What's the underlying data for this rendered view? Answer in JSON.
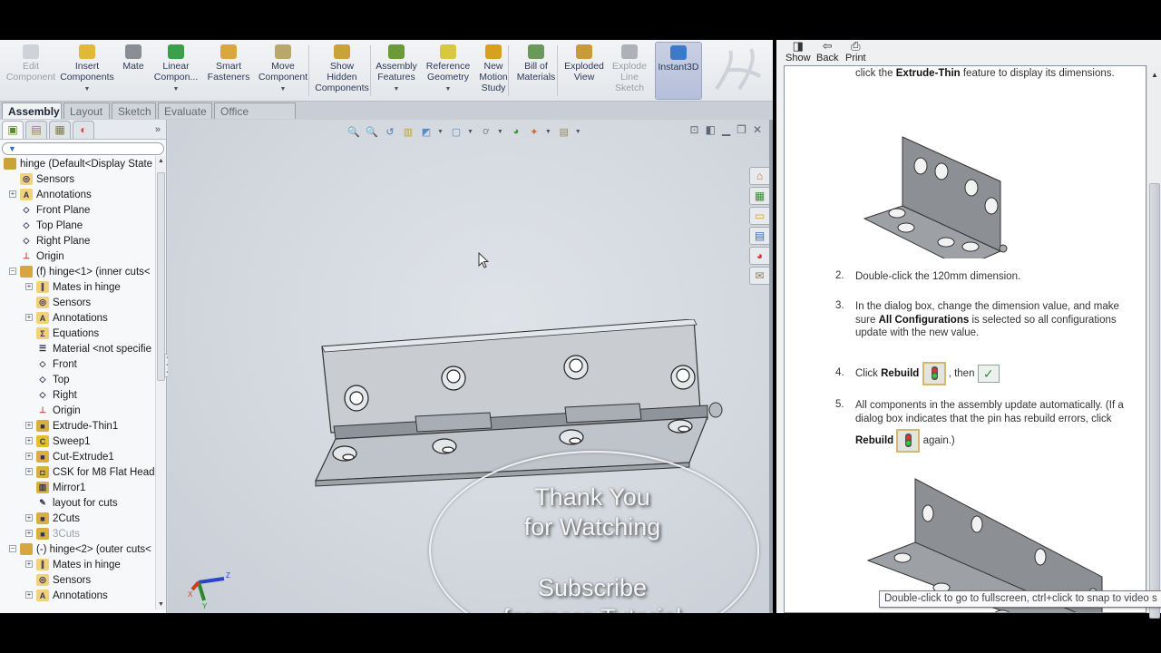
{
  "solidworks": {
    "command_manager": [
      {
        "label": "Edit\nComponent",
        "icon": "edit-component-icon",
        "state": "disabled"
      },
      {
        "label": "Insert\nComponents",
        "icon": "insert-components-icon",
        "dropdown": true
      },
      {
        "label": "Mate",
        "icon": "mate-icon"
      },
      {
        "label": "Linear\nCompon...",
        "icon": "linear-pattern-icon",
        "dropdown": true
      },
      {
        "label": "Smart\nFasteners",
        "icon": "smart-fasteners-icon"
      },
      {
        "label": "Move\nComponent",
        "icon": "move-component-icon",
        "dropdown": true
      },
      {
        "label": "Show\nHidden\nComponents",
        "icon": "show-hidden-icon"
      },
      {
        "label": "Assembly\nFeatures",
        "icon": "assembly-features-icon",
        "dropdown": true
      },
      {
        "label": "Reference\nGeometry",
        "icon": "reference-geometry-icon",
        "dropdown": true
      },
      {
        "label": "New\nMotion\nStudy",
        "icon": "motion-study-icon"
      },
      {
        "label": "Bill of\nMaterials",
        "icon": "bill-of-materials-icon"
      },
      {
        "label": "Exploded\nView",
        "icon": "exploded-view-icon"
      },
      {
        "label": "Explode\nLine\nSketch",
        "icon": "explode-line-sketch-icon",
        "state": "disabled"
      },
      {
        "label": "Instant3D",
        "icon": "instant3d-icon",
        "state": "active"
      }
    ],
    "tabs": [
      {
        "label": "Assembly",
        "active": true
      },
      {
        "label": "Layout"
      },
      {
        "label": "Sketch"
      },
      {
        "label": "Evaluate"
      },
      {
        "label": "Office Products"
      }
    ],
    "feature_manager": {
      "panel_tabs": [
        "featuremanager-tree-icon",
        "propertymanager-icon",
        "configurationmanager-icon",
        "display-manager-icon"
      ],
      "more_label": "»",
      "filter_placeholder": "",
      "tree": [
        {
          "label": "hinge  (Default<Display State",
          "level": 0,
          "icon": "assembly-icon"
        },
        {
          "label": "Sensors",
          "level": 1,
          "icon": "sensors-folder-icon"
        },
        {
          "label": "Annotations",
          "level": 1,
          "icon": "annotations-folder-icon",
          "expandable": true
        },
        {
          "label": "Front Plane",
          "level": 1,
          "icon": "plane-icon"
        },
        {
          "label": "Top Plane",
          "level": 1,
          "icon": "plane-icon"
        },
        {
          "label": "Right Plane",
          "level": 1,
          "icon": "plane-icon"
        },
        {
          "label": "Origin",
          "level": 1,
          "icon": "origin-icon"
        },
        {
          "label": "(f) hinge<1> (inner cuts<",
          "level": 1,
          "icon": "part-icon",
          "expandable": true,
          "expanded": true
        },
        {
          "label": "Mates in hinge",
          "level": 2,
          "icon": "mates-folder-icon",
          "expandable": true
        },
        {
          "label": "Sensors",
          "level": 2,
          "icon": "sensors-folder-icon"
        },
        {
          "label": "Annotations",
          "level": 2,
          "icon": "annotations-folder-icon",
          "expandable": true
        },
        {
          "label": "Equations",
          "level": 2,
          "icon": "equations-folder-icon"
        },
        {
          "label": "Material <not specifie",
          "level": 2,
          "icon": "material-icon"
        },
        {
          "label": "Front",
          "level": 2,
          "icon": "plane-icon"
        },
        {
          "label": "Top",
          "level": 2,
          "icon": "plane-icon"
        },
        {
          "label": "Right",
          "level": 2,
          "icon": "plane-icon"
        },
        {
          "label": "Origin",
          "level": 2,
          "icon": "origin-icon"
        },
        {
          "label": "Extrude-Thin1",
          "level": 2,
          "icon": "extrude-icon",
          "expandable": true
        },
        {
          "label": "Sweep1",
          "level": 2,
          "icon": "sweep-icon",
          "expandable": true
        },
        {
          "label": "Cut-Extrude1",
          "level": 2,
          "icon": "cut-extrude-icon",
          "expandable": true
        },
        {
          "label": "CSK for M8 Flat Head",
          "level": 2,
          "icon": "hole-wizard-icon",
          "expandable": true
        },
        {
          "label": "Mirror1",
          "level": 2,
          "icon": "mirror-icon"
        },
        {
          "label": "layout for cuts",
          "level": 2,
          "icon": "sketch-icon"
        },
        {
          "label": "2Cuts",
          "level": 2,
          "icon": "cut-extrude-icon",
          "expandable": true
        },
        {
          "label": "3Cuts",
          "level": 2,
          "icon": "cut-extrude-icon",
          "expandable": true,
          "suppressed": true
        },
        {
          "label": "(-) hinge<2> (outer cuts<",
          "level": 1,
          "icon": "part-icon",
          "expandable": true,
          "expanded": true
        },
        {
          "label": "Mates in hinge",
          "level": 2,
          "icon": "mates-folder-icon",
          "expandable": true
        },
        {
          "label": "Sensors",
          "level": 2,
          "icon": "sensors-folder-icon"
        },
        {
          "label": "Annotations",
          "level": 2,
          "icon": "annotations-folder-icon",
          "expandable": true
        }
      ]
    },
    "heads_up_toolbar": [
      "zoom-to-fit-icon",
      "zoom-to-area-icon",
      "previous-view-icon",
      "section-view-icon",
      "view-orientation-icon",
      "display-style-icon",
      "hide-show-items-icon",
      "edit-appearance-icon",
      "apply-scene-icon",
      "view-settings-icon"
    ],
    "window_controls": [
      "tile-horizontal-icon",
      "tile-vertical-icon",
      "minimize-icon",
      "restore-icon",
      "close-icon"
    ],
    "task_pane_tabs": [
      "solidworks-resources-icon",
      "design-library-icon",
      "file-explorer-icon",
      "view-palette-icon",
      "appearances-scenes-icon",
      "custom-properties-icon"
    ],
    "overlay": {
      "line1": "Thank You",
      "line2": "for Watching",
      "line3": "Subscribe",
      "line4": "for more Tutorial"
    },
    "triad_axes": [
      "X",
      "Y",
      "Z"
    ]
  },
  "help": {
    "toolbar": [
      {
        "label": "Show",
        "icon": "show-icon"
      },
      {
        "label": "Back",
        "icon": "back-arrow-icon"
      },
      {
        "label": "Print",
        "icon": "printer-icon"
      }
    ],
    "intro": {
      "pre": "click the ",
      "bold": "Extrude-Thin",
      "post": " feature to display its dimensions."
    },
    "steps": [
      {
        "num": "2.",
        "text": "Double-click the 120mm dimension."
      },
      {
        "num": "3.",
        "pre": "In the dialog box, change the dimension value, and make sure ",
        "bold": "All Configurations",
        "post": " is selected so all configurations update with the new value."
      },
      {
        "num": "4.",
        "pre": "Click ",
        "bold": "Rebuild",
        "post": ", then"
      },
      {
        "num": "5.",
        "text": "All components in the assembly update automatically. (If a dialog box indicates that the pin has rebuild errors, click",
        "bold": "Rebuild",
        "post": "again.)"
      }
    ],
    "tooltip": "Double-click to go to fullscreen, ctrl+click to snap to video s"
  }
}
